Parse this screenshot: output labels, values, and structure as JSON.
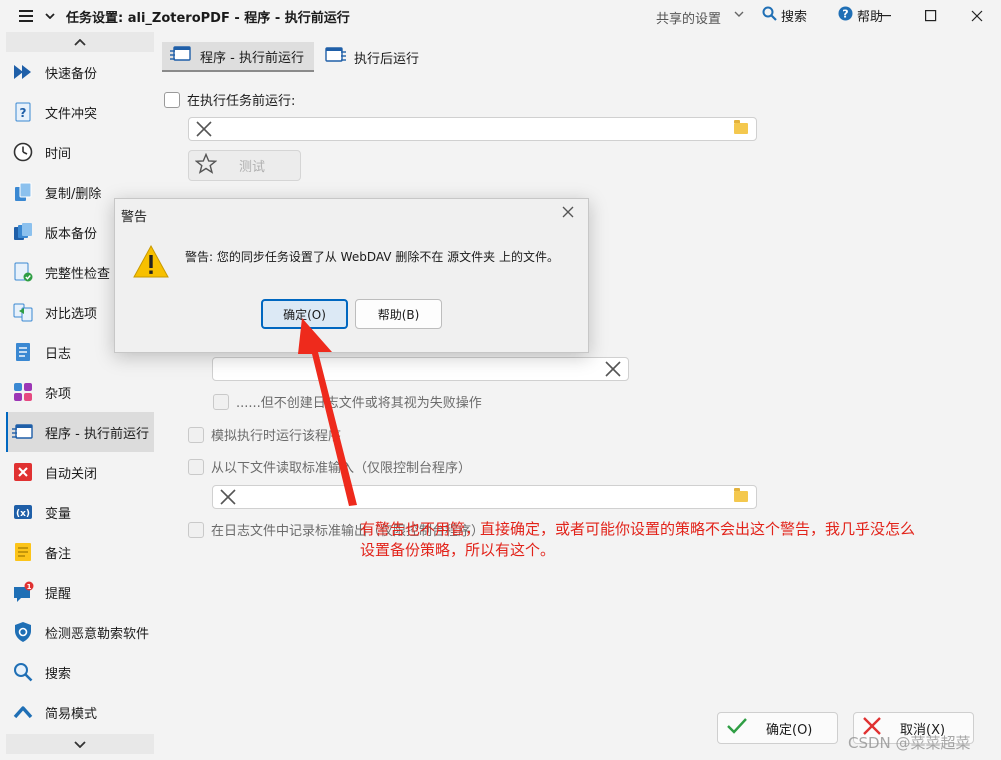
{
  "window": {
    "title": "任务设置: ali_ZoteroPDF - 程序 - 执行前运行",
    "shared_settings": "共享的设置",
    "search": "搜索",
    "help": "帮助"
  },
  "sidebar": {
    "items": [
      {
        "label": "快速备份",
        "icon": "fast-forward-icon"
      },
      {
        "label": "文件冲突",
        "icon": "question-doc-icon"
      },
      {
        "label": "时间",
        "icon": "clock-icon"
      },
      {
        "label": "复制/删除",
        "icon": "copy-icon"
      },
      {
        "label": "版本备份",
        "icon": "versions-icon"
      },
      {
        "label": "完整性检查",
        "icon": "doc-check-icon"
      },
      {
        "label": "对比选项",
        "icon": "compare-icon"
      },
      {
        "label": "日志",
        "icon": "log-icon"
      },
      {
        "label": "杂项",
        "icon": "misc-icon"
      },
      {
        "label": "程序 - 执行前运行",
        "icon": "program-icon"
      },
      {
        "label": "自动关闭",
        "icon": "auto-close-icon"
      },
      {
        "label": "变量",
        "icon": "variables-icon"
      },
      {
        "label": "备注",
        "icon": "note-icon"
      },
      {
        "label": "提醒",
        "icon": "reminder-icon"
      },
      {
        "label": "检测恶意勒索软件",
        "icon": "shield-icon"
      },
      {
        "label": "搜索",
        "icon": "search-icon"
      },
      {
        "label": "简易模式",
        "icon": "simple-mode-icon"
      }
    ],
    "active_index": 9
  },
  "tabs": [
    {
      "label": "程序 - 执行前运行"
    },
    {
      "label": "执行后运行"
    }
  ],
  "form": {
    "run_before": "在执行任务前运行:",
    "test_button": "测试",
    "no_log_or_fail": "......但不创建日志文件或将其视为失败操作",
    "simulate": "模拟执行时运行该程序",
    "stdin": "从以下文件读取标准输入（仅限控制台程序）",
    "log_stdout": "在日志文件中记录标准输出（仅限控制台程序）"
  },
  "dialog": {
    "title": "警告",
    "message": "警告: 您的同步任务设置了从 WebDAV 删除不在 源文件夹 上的文件。",
    "ok": "确定(O)",
    "help": "帮助(B)"
  },
  "annotation": {
    "line1": "有警告也不用管，直接确定，或者可能你设置的策略不会出这个警告，我几乎没怎么",
    "line2": "设置备份策略，所以有这个。",
    "color": "#e2231a"
  },
  "bottom": {
    "ok": "确定(O)",
    "cancel": "取消(X)"
  },
  "watermark": "CSDN @菜菜超菜",
  "colors": {
    "accent": "#0067c0",
    "annotation_red": "#e2231a"
  }
}
